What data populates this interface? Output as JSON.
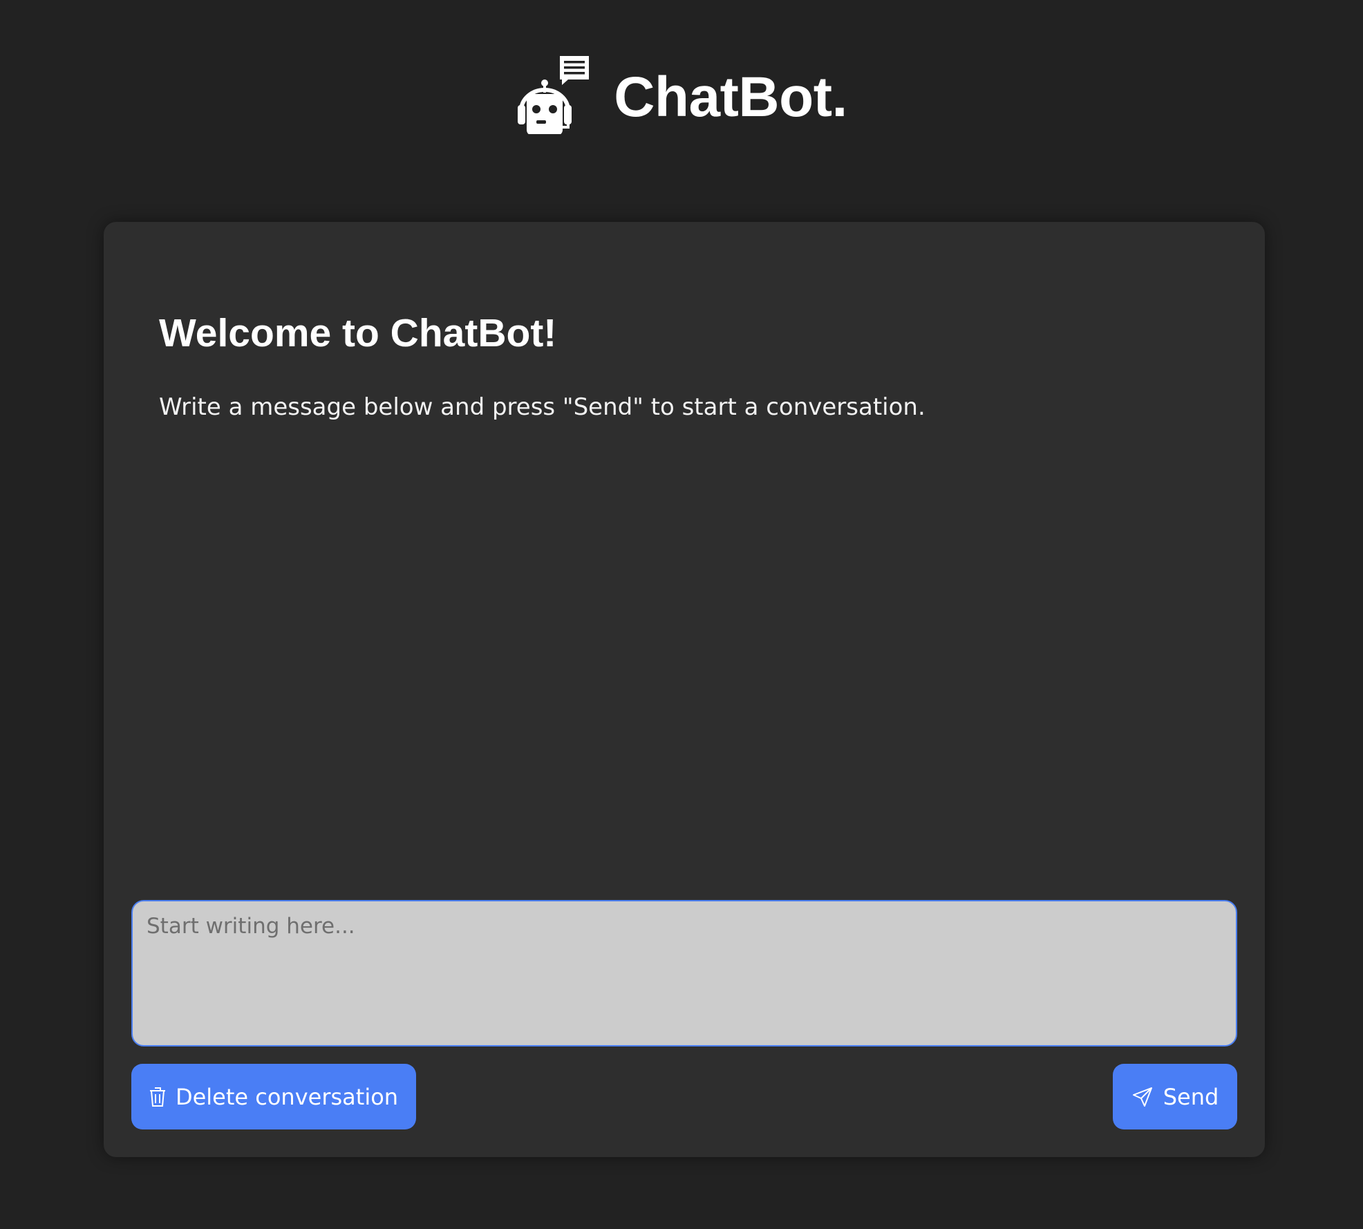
{
  "header": {
    "brand": "ChatBot."
  },
  "welcome": {
    "title": "Welcome to ChatBot!",
    "text": "Write a message below and press \"Send\" to start a conversation."
  },
  "composer": {
    "value": "",
    "placeholder": "Start writing here..."
  },
  "actions": {
    "delete_label": "Delete conversation",
    "delete_icon": "trash-icon",
    "send_label": "Send",
    "send_icon": "paper-plane-icon"
  },
  "colors": {
    "background": "#222222",
    "card": "#2e2e2e",
    "accent": "#4a7ef5",
    "input": "#cccccc"
  }
}
